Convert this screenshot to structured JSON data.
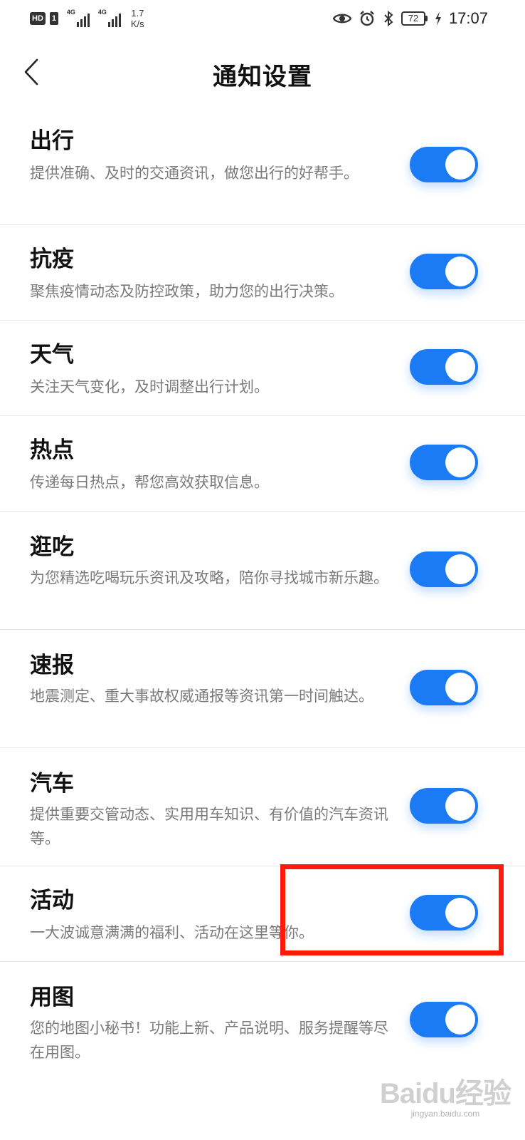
{
  "status_bar": {
    "hd_label": "HD",
    "sim_number": "1",
    "signal_1_label": "4G",
    "signal_2_label": "4G",
    "speed_value": "1.7",
    "speed_unit": "K/s",
    "battery_level": "72",
    "time": "17:07"
  },
  "header": {
    "title": "通知设置"
  },
  "settings": [
    {
      "title": "出行",
      "description": "提供准确、及时的交通资讯，做您出行的好帮手。",
      "enabled": true
    },
    {
      "title": "抗疫",
      "description": "聚焦疫情动态及防控政策，助力您的出行决策。",
      "enabled": true
    },
    {
      "title": "天气",
      "description": "关注天气变化，及时调整出行计划。",
      "enabled": true
    },
    {
      "title": "热点",
      "description": "传递每日热点，帮您高效获取信息。",
      "enabled": true
    },
    {
      "title": "逛吃",
      "description": "为您精选吃喝玩乐资讯及攻略，陪你寻找城市新乐趣。",
      "enabled": true
    },
    {
      "title": "速报",
      "description": "地震测定、重大事故权威通报等资讯第一时间触达。",
      "enabled": true
    },
    {
      "title": "汽车",
      "description": "提供重要交管动态、实用用车知识、有价值的汽车资讯等。",
      "enabled": true
    },
    {
      "title": "活动",
      "description": "一大波诚意满满的福利、活动在这里等你。",
      "enabled": true
    },
    {
      "title": "用图",
      "description": "您的地图小秘书！功能上新、产品说明、服务提醒等尽在用图。",
      "enabled": true
    }
  ],
  "watermark": {
    "main": "Baidu经验",
    "sub": "jingyan.baidu.com"
  },
  "colors": {
    "toggle_on": "#1a7bf5",
    "highlight": "#ff1a0a"
  },
  "icons": {
    "back": "chevron-left-icon",
    "eye": "eye-icon",
    "alarm": "alarm-icon",
    "bluetooth": "bluetooth-icon",
    "charging": "lightning-icon"
  }
}
